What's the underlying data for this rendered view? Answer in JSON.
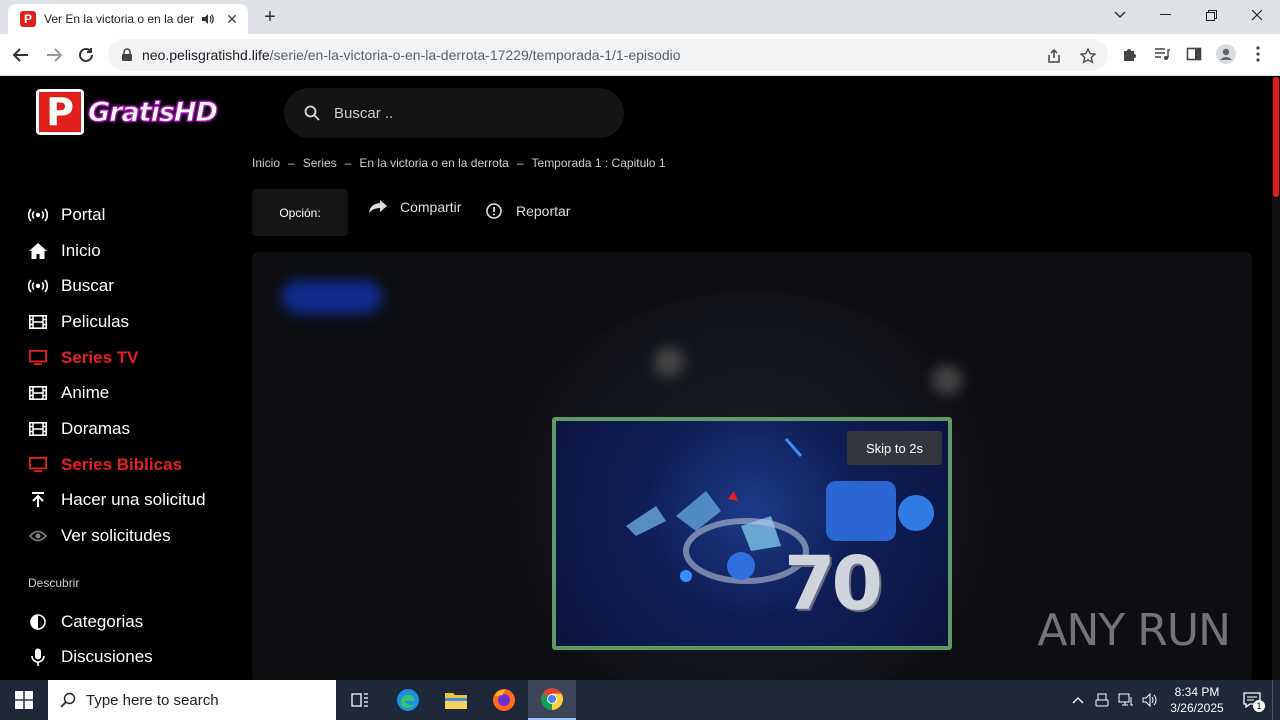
{
  "browser": {
    "tab_title": "Ver En la victoria o en la derrota",
    "favicon_letter": "P",
    "url_host": "neo.pelisgratishd.life",
    "url_path": "/serie/en-la-victoria-o-en-la-derrota-17229/temporada-1/1-episodio"
  },
  "site": {
    "logo_letter": "P",
    "logo_text": "GratisHD",
    "search_placeholder": "Buscar ..",
    "accent_color": "#e41e26"
  },
  "sidebar": {
    "items": [
      {
        "label": "Portal",
        "icon": "broadcast-icon",
        "active": false
      },
      {
        "label": "Inicio",
        "icon": "home-icon",
        "active": false
      },
      {
        "label": "Buscar",
        "icon": "broadcast-icon",
        "active": false
      },
      {
        "label": "Peliculas",
        "icon": "film-icon",
        "active": false
      },
      {
        "label": "Series TV",
        "icon": "tv-icon",
        "active": true
      },
      {
        "label": "Anime",
        "icon": "film-icon",
        "active": false
      },
      {
        "label": "Doramas",
        "icon": "film-icon",
        "active": false
      },
      {
        "label": "Series Biblicas",
        "icon": "tv-icon",
        "active": true
      },
      {
        "label": "Hacer una solicitud",
        "icon": "upload-icon",
        "active": false
      },
      {
        "label": "Ver solicitudes",
        "icon": "eye-icon",
        "active": false
      }
    ],
    "section_title": "Descubrir",
    "discover_items": [
      {
        "label": "Categorias",
        "icon": "half-circle-icon"
      },
      {
        "label": "Discusiones",
        "icon": "microphone-icon"
      }
    ]
  },
  "breadcrumb": [
    "Inicio",
    "Series",
    "En la victoria o en la derrota",
    "Temporada 1 : Capitulo 1"
  ],
  "actions": {
    "option_label": "Opción:",
    "share_label": "Compartir",
    "report_label": "Reportar"
  },
  "ad": {
    "skip_label": "Skip to 2s",
    "big_text": "70"
  },
  "watermark": "ANY RUN",
  "taskbar": {
    "search_placeholder": "Type here to search",
    "time": "8:34 PM",
    "date": "3/26/2025",
    "notification_count": "1"
  }
}
